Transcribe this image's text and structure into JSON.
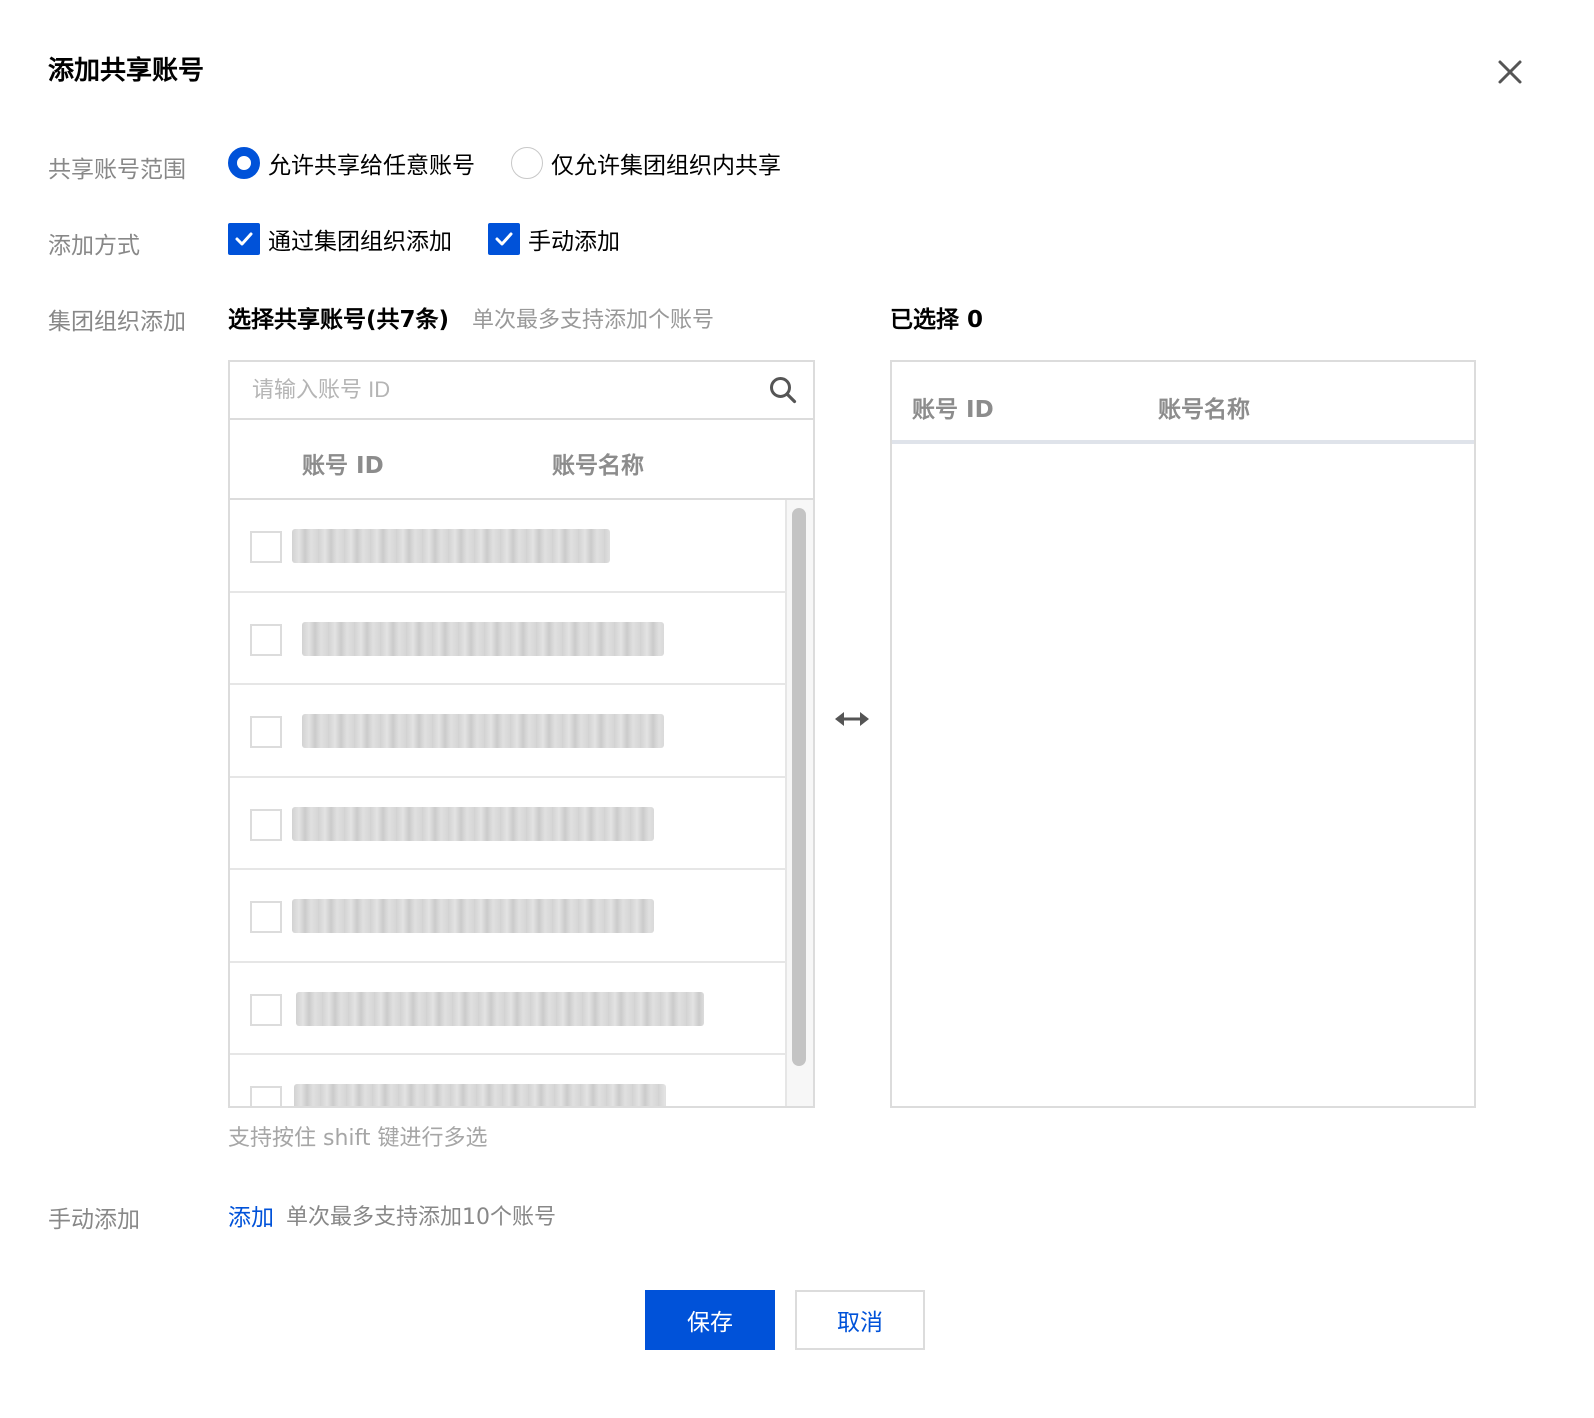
{
  "dialog": {
    "title": "添加共享账号"
  },
  "form": {
    "scope_label": "共享账号范围",
    "scope_options": [
      "允许共享给任意账号",
      "仅允许集团组织内共享"
    ],
    "scope_selected": "允许共享给任意账号",
    "method_label": "添加方式",
    "method_options": [
      {
        "label": "通过集团组织添加",
        "checked": true
      },
      {
        "label": "手动添加",
        "checked": true
      }
    ],
    "org_label": "集团组织添加",
    "manual_label": "手动添加"
  },
  "transfer": {
    "source_title": "选择共享账号(共7条)",
    "source_hint": "单次最多支持添加个账号",
    "search_placeholder": "请输入账号 ID",
    "columns": [
      "账号 ID",
      "账号名称"
    ],
    "target_title": "已选择 0",
    "target_columns": [
      "账号 ID",
      "账号名称"
    ],
    "shift_hint": "支持按住 shift 键进行多选"
  },
  "manual": {
    "link": "添加",
    "hint": "单次最多支持添加10个账号"
  },
  "buttons": {
    "save": "保存",
    "cancel": "取消"
  },
  "colors": {
    "primary": "#0052d9",
    "label_gray": "#888888",
    "border": "#dcdcdc"
  }
}
